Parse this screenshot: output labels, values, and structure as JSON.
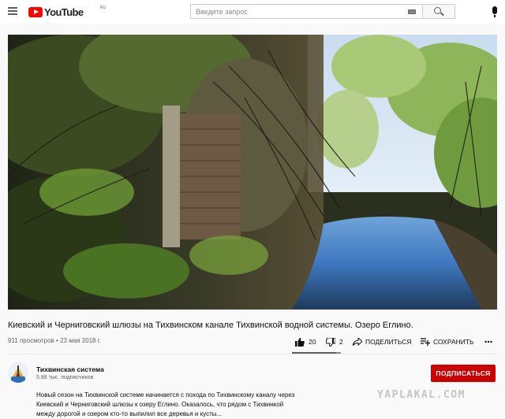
{
  "header": {
    "logo_text": "YouTube",
    "logo_region": "RU",
    "search_placeholder": "Введите запрос",
    "icons": [
      "menu-icon",
      "youtube-logo-icon",
      "keyboard-icon",
      "search-icon",
      "mic-icon"
    ]
  },
  "video": {
    "title": "Киевский и Черниговский шлюзы на Тихвинском канале Тихвинской водной системы. Озеро Еглино.",
    "views": "911 просмотров",
    "separator": "•",
    "date": "23 мая 2018 г.",
    "likes": "20",
    "dislikes": "2",
    "like_ratio": 0.91,
    "share_label": "ПОДЕЛИТЬСЯ",
    "save_label": "СОХРАНИТЬ"
  },
  "channel": {
    "name": "Тихвинская система",
    "subscribers": "5,88 тыс. подписчиков",
    "subscribe_label": "ПОДПИСАТЬСЯ"
  },
  "description": {
    "lines": [
      "Новый сезон на Тихвинской системе начинается с похода по Тихвинскому каналу через",
      "Киевский и Черниговский шлюзы к озеру Еглино. Оказалось, что рядом с Тихвинкой",
      "между дорогой и озером кто-то выпилил все деревья и кусты..."
    ]
  },
  "watermark": "YAPLAKAL.COM",
  "colors": {
    "brand_red": "#ff0000",
    "subscribe_red": "#cc0000",
    "text_primary": "#0f0f0f",
    "text_secondary": "#606060",
    "background": "#f9f9f9"
  }
}
